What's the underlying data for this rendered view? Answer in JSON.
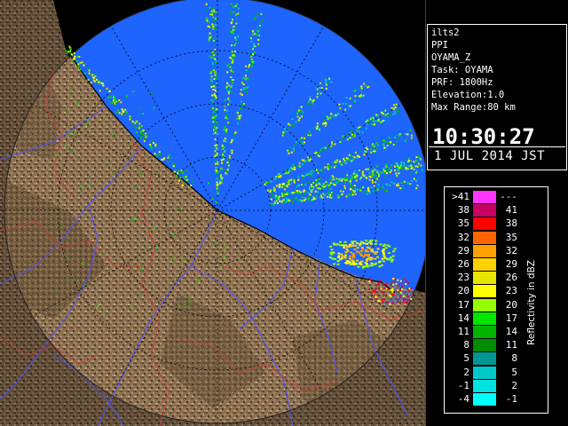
{
  "product": {
    "site": "ilts2",
    "scan_type": "PPI",
    "parameter": "OYAMA_Z",
    "task": "Task: OYAMA",
    "prf": "PRF: 1800Hz",
    "elevation": "Elevation:1.0",
    "max_range": "Max Range:80 km",
    "time": "10:30:27",
    "date": "1 JUL 2014 JST"
  },
  "legend": {
    "title": "Reflectivity in dBZ",
    "left_values": [
      ">41",
      "38",
      "35",
      "32",
      "29",
      "26",
      "23",
      "20",
      "17",
      "14",
      "11",
      "8",
      "5",
      "2",
      "-1",
      "-4"
    ],
    "right_values": [
      "---",
      "41",
      "38",
      "35",
      "32",
      "29",
      "26",
      "23",
      "20",
      "17",
      "14",
      "11",
      "8",
      "5",
      "2",
      "-1"
    ],
    "colors": [
      "#ff33ff",
      "#c80064",
      "#ff0000",
      "#ff6400",
      "#ffa000",
      "#ffd200",
      "#e6e600",
      "#ffff00",
      "#96ff00",
      "#00e600",
      "#00b400",
      "#008c00",
      "#009696",
      "#00c8c8",
      "#00e1e1",
      "#00ffff"
    ]
  },
  "map_colors": {
    "sea": "#1e64ff",
    "land": "#8c7050",
    "range_ring": "#000000",
    "river": "#5050ff",
    "boundary": "#c83c3c"
  }
}
